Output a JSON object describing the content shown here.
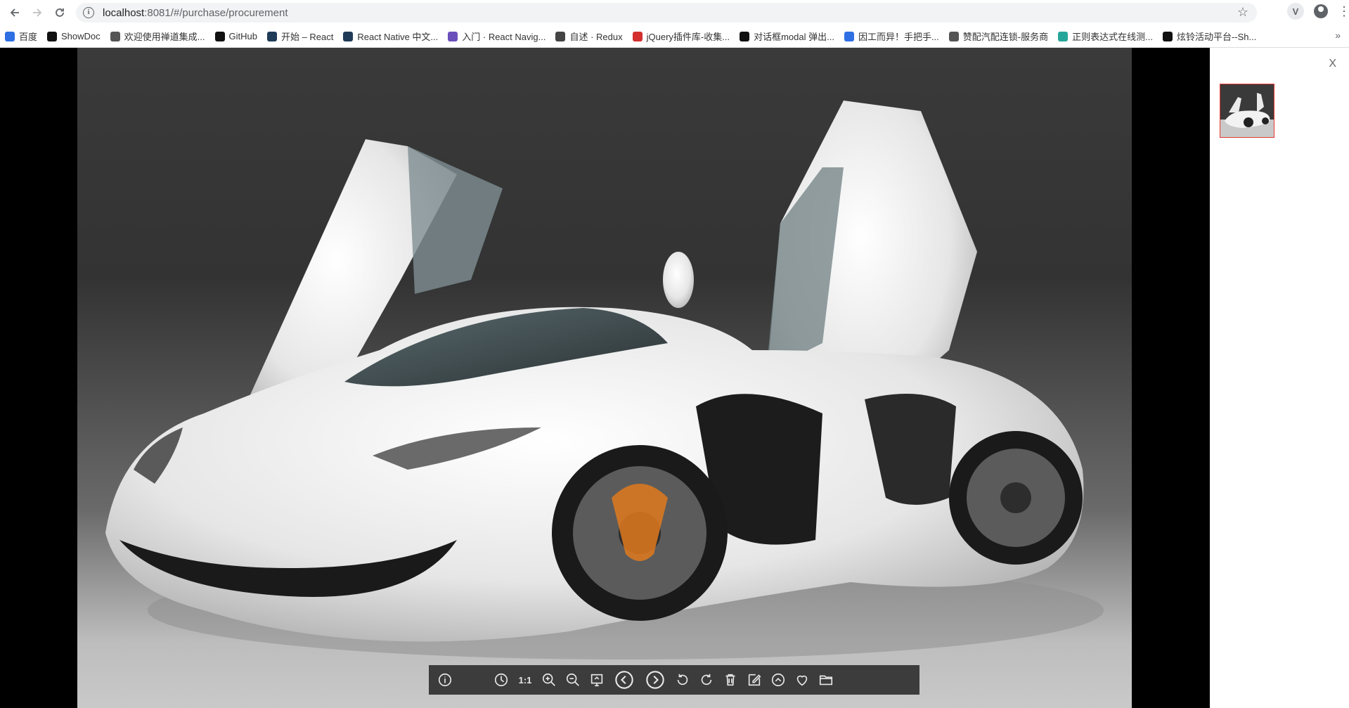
{
  "browser": {
    "url_host": "localhost",
    "url_path": ":8081/#/purchase/procurement",
    "ext_label": "V"
  },
  "bookmarks": [
    {
      "label": "百度",
      "color": "#2f6fe4"
    },
    {
      "label": "ShowDoc",
      "color": "#111111"
    },
    {
      "label": "欢迎使用禅道集成...",
      "color": "#555555"
    },
    {
      "label": "GitHub",
      "color": "#111111"
    },
    {
      "label": "开始 – React",
      "color": "#1f3b57"
    },
    {
      "label": "React Native 中文...",
      "color": "#1f3b57"
    },
    {
      "label": "入门 · React Navig...",
      "color": "#6b4fbb"
    },
    {
      "label": "自述 · Redux",
      "color": "#444444"
    },
    {
      "label": "jQuery插件库-收集...",
      "color": "#d32f2f"
    },
    {
      "label": "对话框modal 弹出...",
      "color": "#111111"
    },
    {
      "label": "因工而异！手把手...",
      "color": "#2f6fe4"
    },
    {
      "label": "赞配汽配连锁-服务商",
      "color": "#555555"
    },
    {
      "label": "正则表达式在线测...",
      "color": "#26a69a"
    },
    {
      "label": "炫铃活动平台--Sh...",
      "color": "#111111"
    }
  ],
  "viewer": {
    "toolbar": {
      "ratio_label": "1:1"
    }
  },
  "side": {
    "close_label": "X"
  },
  "colors": {
    "thumb_border": "#e53935",
    "toolbar_bg": "#3c3c3c",
    "viewer_bg": "#000000"
  },
  "icons": [
    "back-icon",
    "forward-icon",
    "reload-icon",
    "info-icon",
    "star-icon",
    "extension-icon",
    "account-icon",
    "menu-icon",
    "chevron-right-icon",
    "rotate-left-icon",
    "rotate-right-icon",
    "zoom-in-icon",
    "zoom-out-icon",
    "prev-icon",
    "next-icon",
    "delete-icon",
    "edit-icon",
    "heart-icon",
    "folder-icon",
    "play-icon",
    "fullscreen-icon"
  ]
}
